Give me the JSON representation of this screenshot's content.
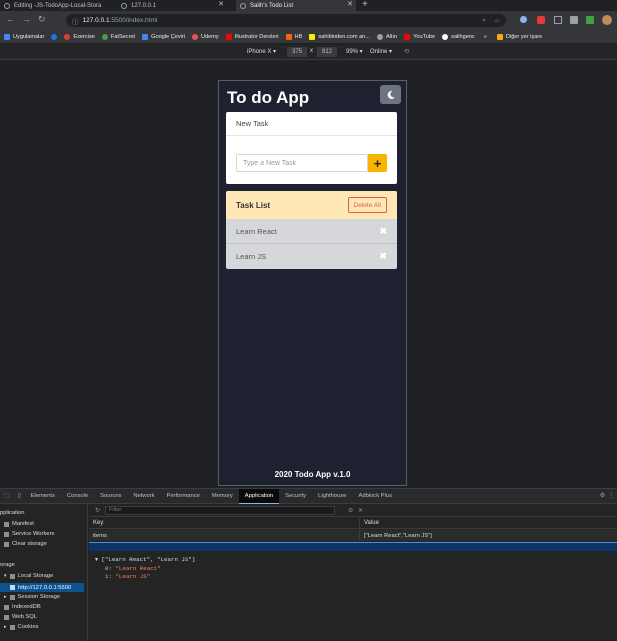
{
  "browser": {
    "tabs": [
      {
        "title": "Editing -JS-TodoApp-Local-Stora",
        "active": false
      },
      {
        "title": "127.0.0.1",
        "active": false
      },
      {
        "title": "Salih's Todo List",
        "active": true
      }
    ],
    "new_tab_glyph": "+",
    "url_host": "127.0.0.1",
    "url_path": ":5500/index.html",
    "bookmarks": [
      {
        "label": "Uygulamalar",
        "icon": "apps-grid-icon",
        "color": "#4285f4"
      },
      {
        "label": "",
        "icon": "facebook-icon",
        "color": "#1877f2"
      },
      {
        "label": "Exercise",
        "icon": "exercise-icon",
        "color": "#e53935"
      },
      {
        "label": "FatSecret",
        "icon": "fatsecret-icon",
        "color": "#43a047"
      },
      {
        "label": "Google Çeviri",
        "icon": "translate-icon",
        "color": "#4285f4"
      },
      {
        "label": "Udemy",
        "icon": "udemy-icon",
        "color": "#ec5252"
      },
      {
        "label": "Illustrator Dersleri",
        "icon": "youtube-icon",
        "color": "#ff0000"
      },
      {
        "label": "HB",
        "icon": "hb-icon",
        "color": "#ff6000"
      },
      {
        "label": "sahibinden.com an...",
        "icon": "sahibinden-icon",
        "color": "#ffe800"
      },
      {
        "label": "Altın",
        "icon": "gold-icon",
        "color": "#9e9e9e"
      },
      {
        "label": "YouTube",
        "icon": "youtube-icon",
        "color": "#ff0000"
      },
      {
        "label": "salihgenc",
        "icon": "github-icon",
        "color": "#ffffff"
      }
    ],
    "bookmarks_more": "»",
    "other_bookmarks": "Diğer yer işare"
  },
  "device_toolbar": {
    "device": "iPhone X ▾",
    "width": "375",
    "times": "x",
    "height": "812",
    "zoom": "99% ▾",
    "network": "Online ▾"
  },
  "app": {
    "title": "To do App",
    "new_task_header": "New Task",
    "input_placeholder": "Type a New Task",
    "add_label": "+",
    "task_list_header": "Task List",
    "delete_all_label": "Delete All",
    "tasks": [
      {
        "text": "Learn React",
        "remove": "✖"
      },
      {
        "text": "Learn JS",
        "remove": "✖"
      }
    ],
    "footer": "2020 Todo App v.1.0"
  },
  "devtools": {
    "tabs": [
      "Elements",
      "Console",
      "Sources",
      "Network",
      "Performance",
      "Memory",
      "Application",
      "Security",
      "Lighthouse",
      "Adblock Plus"
    ],
    "active_tab": "Application",
    "sidebar": {
      "section_app": "pplication",
      "manifest": "Manifest",
      "service_workers": "Service Workers",
      "clear_storage": "Clear storage",
      "section_storage": "orage",
      "local_storage": "Local Storage",
      "local_storage_origin": "http://127.0.0.1:5500",
      "session_storage": "Session Storage",
      "indexeddb": "IndexedDB",
      "websql": "Web SQL",
      "cookies": "Cookies"
    },
    "filter_placeholder": "Filter",
    "table": {
      "key_header": "Key",
      "value_header": "Value",
      "rows": [
        {
          "key": "items",
          "value": "[\"Learn React\",\"Learn JS\"]"
        }
      ]
    },
    "preview": {
      "line0": "▾ [\"Learn React\", \"Learn JS\"]",
      "line1_idx": "0:",
      "line1_val": "\"Learn React\"",
      "line2_idx": "1:",
      "line2_val": "\"Learn JS\""
    }
  }
}
